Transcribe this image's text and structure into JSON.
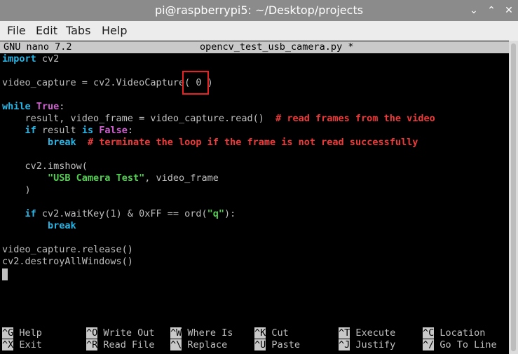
{
  "window": {
    "title": "pi@raspberrypi5: ~/Desktop/projects",
    "minimize_glyph": "⌄",
    "maximize_glyph": "⌃",
    "close_glyph": "✕"
  },
  "menu": {
    "items": [
      "File",
      "Edit",
      "Tabs",
      "Help"
    ]
  },
  "nano": {
    "version": "GNU nano 7.2",
    "filename": "opencv_test_usb_camera.py *"
  },
  "code": {
    "l1_kw": "import",
    "l1_rest": " cv2",
    "l3_pre": "video_capture = cv2.VideoCapture",
    "l3_arg": "( 0 )",
    "l5_kw": "while",
    "l5_bool": "True",
    "l5_colon": ":",
    "l6_code": "    result, video_frame = video_capture.read()  ",
    "l6_comment": "# read frames from the video",
    "l7_indent": "    ",
    "l7_if": "if",
    "l7_mid": " result ",
    "l7_is": "is",
    "l7_sp": " ",
    "l7_false": "False",
    "l7_colon": ":",
    "l8_indent": "        ",
    "l8_break": "break",
    "l8_sp": "  ",
    "l8_comment": "# terminate the loop if the frame is not read successfully",
    "l10": "    cv2.imshow(",
    "l11_indent": "        ",
    "l11_str": "\"USB Camera Test\"",
    "l11_rest": ", video_frame",
    "l12": "    )",
    "l14_indent": "    ",
    "l14_if": "if",
    "l14_mid": " cv2.waitKey(1) & 0xFF == ord(",
    "l14_str": "\"q\"",
    "l14_end": "):",
    "l15_indent": "        ",
    "l15_break": "break",
    "l17": "video_capture.release()",
    "l18": "cv2.destroyAllWindows()"
  },
  "shortcuts": [
    {
      "key": "^G",
      "label": "Help"
    },
    {
      "key": "^O",
      "label": "Write Out"
    },
    {
      "key": "^W",
      "label": "Where Is"
    },
    {
      "key": "^K",
      "label": "Cut"
    },
    {
      "key": "^T",
      "label": "Execute"
    },
    {
      "key": "^C",
      "label": "Location"
    },
    {
      "key": "^X",
      "label": "Exit"
    },
    {
      "key": "^R",
      "label": "Read File"
    },
    {
      "key": "^\\",
      "label": "Replace"
    },
    {
      "key": "^U",
      "label": "Paste"
    },
    {
      "key": "^J",
      "label": "Justify"
    },
    {
      "key": "^/",
      "label": "Go To Line"
    }
  ]
}
